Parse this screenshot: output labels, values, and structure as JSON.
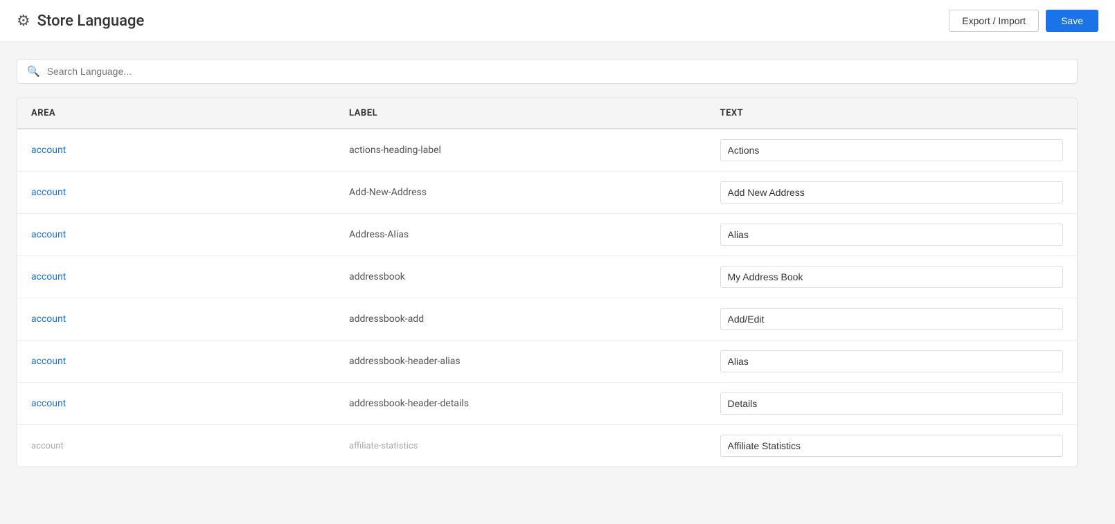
{
  "header": {
    "title": "Store Language",
    "export_import_label": "Export / Import",
    "save_label": "Save"
  },
  "search": {
    "placeholder": "Search Language..."
  },
  "table": {
    "columns": [
      "AREA",
      "LABEL",
      "TEXT"
    ],
    "rows": [
      {
        "area": "account",
        "label": "actions-heading-label",
        "text": "Actions"
      },
      {
        "area": "account",
        "label": "Add-New-Address",
        "text": "Add New Address"
      },
      {
        "area": "account",
        "label": "Address-Alias",
        "text": "Alias"
      },
      {
        "area": "account",
        "label": "addressbook",
        "text": "My Address Book"
      },
      {
        "area": "account",
        "label": "addressbook-add",
        "text": "Add/Edit"
      },
      {
        "area": "account",
        "label": "addressbook-header-alias",
        "text": "Alias"
      },
      {
        "area": "account",
        "label": "addressbook-header-details",
        "text": "Details"
      },
      {
        "area": "account",
        "label": "affiliate-statistics",
        "text": "Affiliate Statistics"
      }
    ]
  }
}
